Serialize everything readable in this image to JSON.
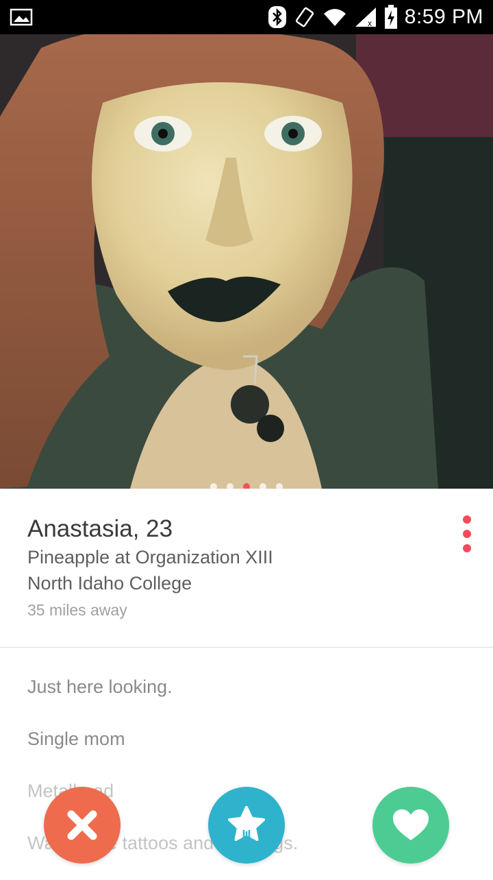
{
  "status_bar": {
    "time": "8:59 PM",
    "icons": [
      "image-notification-icon",
      "bluetooth-icon",
      "vibrate-icon",
      "wifi-icon",
      "signal-icon",
      "battery-charging-icon"
    ]
  },
  "photo": {
    "indicator_count": 5,
    "active_index": 2
  },
  "profile": {
    "name_age": "Anastasia, 23",
    "job": "Pineapple at Organization XIII",
    "school": "North Idaho College",
    "distance": "35 miles away"
  },
  "bio": {
    "lines": [
      "Just here looking.",
      "Single mom",
      "Metalhead",
      "Want more tattoos and piercings."
    ]
  },
  "actions": {
    "nope_icon": "close-x-icon",
    "super_like_icon": "star-icon",
    "like_icon": "heart-icon"
  },
  "colors": {
    "accent": "#f24a5a",
    "nope": "#ee6b4d",
    "super_like": "#2fb3cc",
    "like": "#4ccc93"
  }
}
